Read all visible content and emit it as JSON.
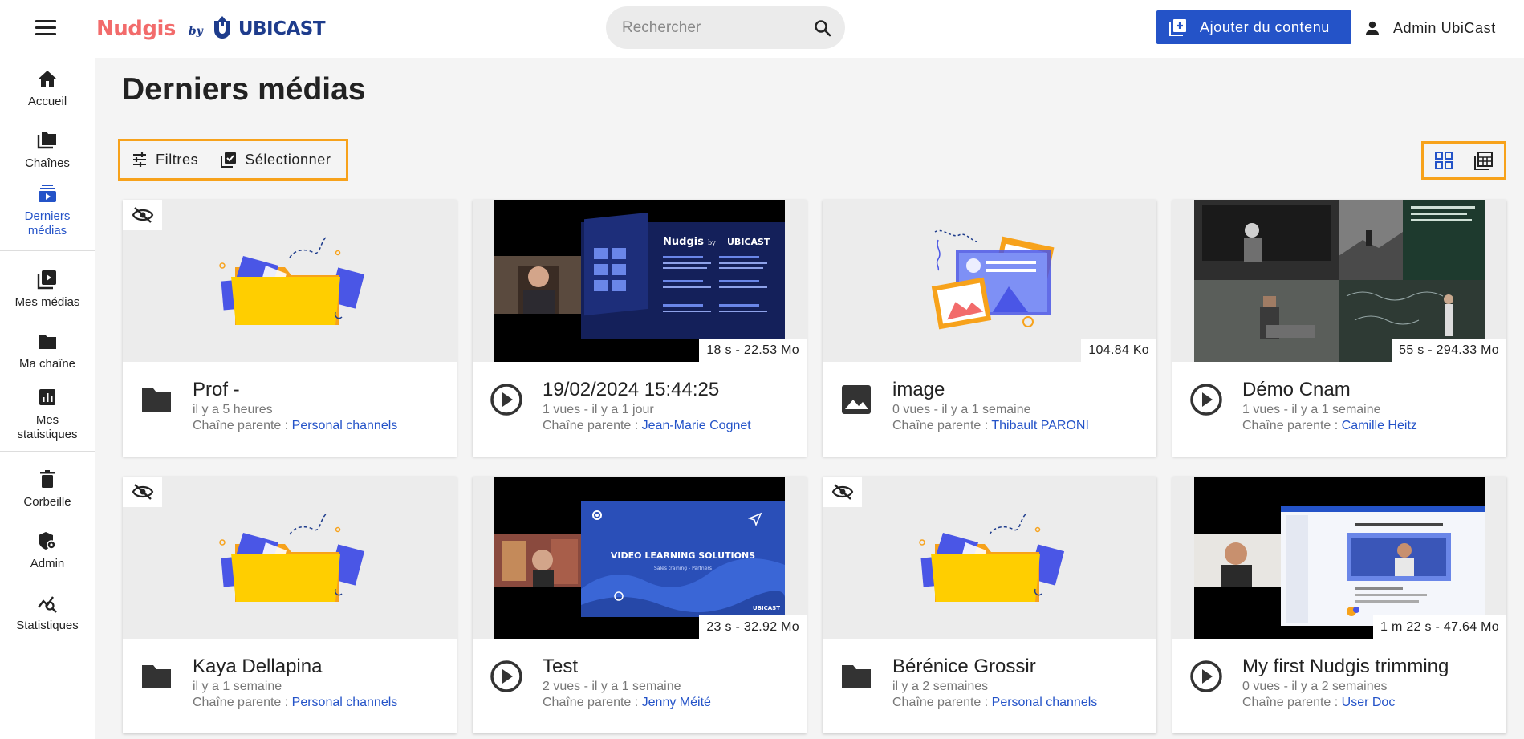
{
  "header": {
    "logo_brand": "Nudgis",
    "logo_by": "by",
    "logo_company": "UBICAST",
    "search_placeholder": "Rechercher",
    "add_content_label": "Ajouter du contenu",
    "user_name": "Admin UbiCast"
  },
  "sidebar": {
    "items": [
      {
        "label": "Accueil",
        "icon": "home-icon"
      },
      {
        "label": "Chaînes",
        "icon": "channels-icon"
      },
      {
        "label": "Derniers médias",
        "icon": "latest-media-icon",
        "active": true
      },
      {
        "label": "Mes médias",
        "icon": "my-media-icon"
      },
      {
        "label": "Ma chaîne",
        "icon": "folder-icon"
      },
      {
        "label": "Mes statistiques",
        "icon": "stats-icon"
      },
      {
        "label": "Corbeille",
        "icon": "trash-icon"
      },
      {
        "label": "Admin",
        "icon": "admin-shield-icon"
      },
      {
        "label": "Statistiques",
        "icon": "analytics-icon"
      }
    ]
  },
  "main": {
    "title": "Derniers médias",
    "filters_label": "Filtres",
    "select_label": "Sélectionner"
  },
  "cards": [
    {
      "title": "Prof -",
      "meta": "il y a 5 heures",
      "parent_prefix": "Chaîne parente : ",
      "parent": "Personal channels",
      "type": "channel",
      "hidden": true
    },
    {
      "title": "19/02/2024 15:44:25",
      "meta": "1 vues  - il y a 1 jour",
      "parent_prefix": "Chaîne parente : ",
      "parent": "Jean-Marie Cognet",
      "type": "video",
      "duration": "18 s - 22.53 Mo"
    },
    {
      "title": "image",
      "meta": "0 vues  - il y a 1 semaine",
      "parent_prefix": "Chaîne parente : ",
      "parent": "Thibault PARONI",
      "type": "image",
      "duration": "104.84 Ko"
    },
    {
      "title": "Démo Cnam",
      "meta": "1 vues  - il y a 1 semaine",
      "parent_prefix": "Chaîne parente : ",
      "parent": "Camille Heitz",
      "type": "video",
      "duration": "55 s - 294.33 Mo"
    },
    {
      "title": "Kaya Dellapina",
      "meta": "il y a 1 semaine",
      "parent_prefix": "Chaîne parente : ",
      "parent": "Personal channels",
      "type": "channel",
      "hidden": true
    },
    {
      "title": "Test",
      "meta": "2 vues  - il y a 1 semaine",
      "parent_prefix": "Chaîne parente : ",
      "parent": "Jenny Méité",
      "type": "video",
      "duration": "23 s - 32.92 Mo"
    },
    {
      "title": "Bérénice Grossir",
      "meta": "il y a 2 semaines",
      "parent_prefix": "Chaîne parente : ",
      "parent": "Personal channels",
      "type": "channel",
      "hidden": true
    },
    {
      "title": "My first Nudgis trimming",
      "meta": "0 vues  - il y a 2 semaines",
      "parent_prefix": "Chaîne parente : ",
      "parent": "User Doc",
      "type": "video",
      "duration": "1 m 22 s - 47.64 Mo"
    }
  ],
  "thumb_text": {
    "video_learning": "VIDEO LEARNING SOLUTIONS",
    "sales_training": "Sales training - Partners",
    "slide_brand": "Nudgis",
    "slide_by": "by",
    "slide_company": "UBICAST",
    "slide_company_small": "UBICAST"
  },
  "colors": {
    "accent": "#2453c8",
    "highlight": "#f7a21b",
    "logo_red": "#f26b6b",
    "logo_blue": "#1e3c8c"
  }
}
